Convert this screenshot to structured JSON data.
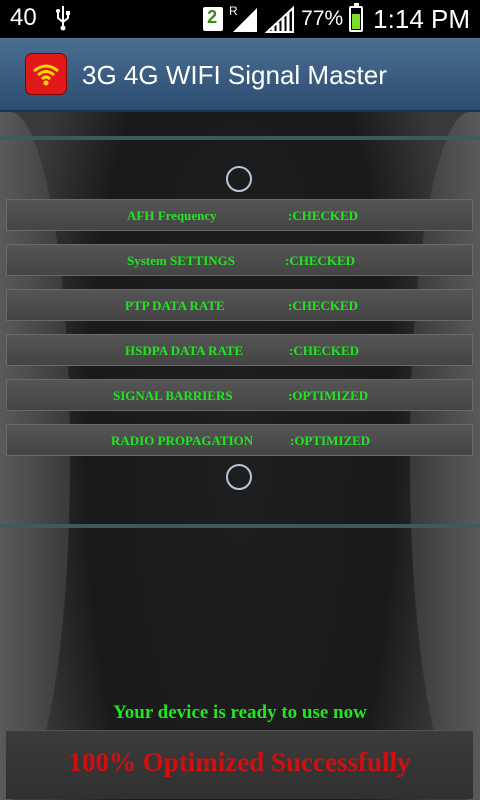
{
  "status_bar": {
    "notification_count": "40",
    "sim_badge": "2",
    "roaming": "R",
    "battery_percent": "77%",
    "time": "1:14 PM",
    "icons": [
      "usb-icon",
      "sim-icon",
      "signal-icon",
      "battery-charging-icon"
    ]
  },
  "app_bar": {
    "title": "3G 4G WIFI Signal Master",
    "icon": "wifi-icon",
    "icon_color": "#e01818"
  },
  "checks": [
    {
      "label": "AFH Frequency",
      "status": ":CHECKED"
    },
    {
      "label": "System SETTINGS",
      "status": ":CHECKED"
    },
    {
      "label": "PTP DATA RATE",
      "status": ":CHECKED"
    },
    {
      "label": "HSDPA DATA RATE",
      "status": ":CHECKED"
    },
    {
      "label": "SIGNAL BARRIERS",
      "status": ":OPTIMIZED"
    },
    {
      "label": "RADIO PROPAGATION",
      "status": ":OPTIMIZED"
    }
  ],
  "ready_message": "Your device is ready to use now",
  "success_message": "100% Optimized Successfully",
  "colors": {
    "status_text": "#22e522",
    "success_text": "#d01010",
    "title_bar": "#3a5f84"
  }
}
